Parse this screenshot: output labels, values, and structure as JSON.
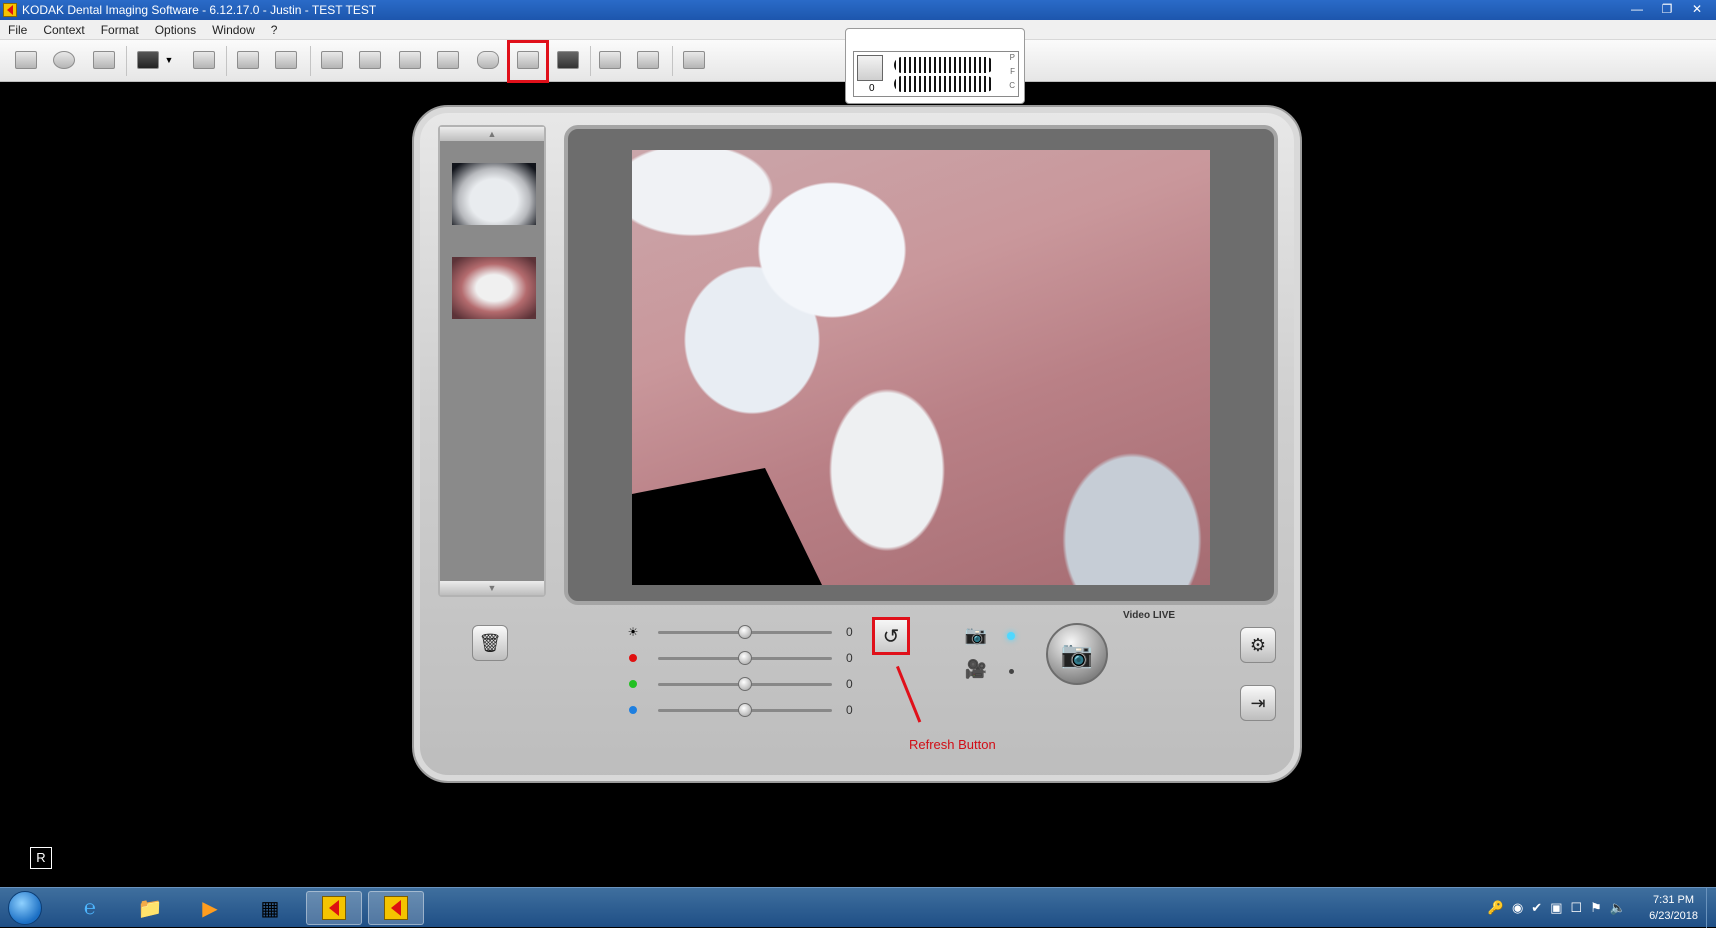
{
  "window": {
    "title": "KODAK Dental Imaging Software - 6.12.17.0 - Justin  - TEST TEST",
    "controls": [
      "minimize-icon",
      "restore-icon",
      "close-icon"
    ]
  },
  "menu": [
    "File",
    "Context",
    "Format",
    "Options",
    "Window",
    "?"
  ],
  "toolbar": {
    "buttons": [
      "open-folder-icon",
      "cd-icon",
      "compare-icon",
      "layout-icon",
      "dropdown-arrow-icon",
      "tooth-tools-icon",
      "email-icon",
      "print-icon",
      "intraoral-sensor-icon",
      "panoramic-icon",
      "cephalometric-icon",
      "scanner-icon",
      "cr-icon",
      "intraoral-camera-icon",
      "acquire-icon",
      "photo-icon",
      "presentation-icon",
      "exit-icon"
    ],
    "highlighted": "intraoral-camera-icon"
  },
  "chart_popup": {
    "count": "0",
    "labels": [
      "P",
      "F",
      "C"
    ]
  },
  "camera": {
    "status_label": "Video LIVE",
    "sliders": [
      {
        "name": "brightness",
        "icon": "sun-icon",
        "value": "0",
        "position": 0.5
      },
      {
        "name": "red",
        "icon": "red-dot",
        "color": "#e01010",
        "value": "0",
        "position": 0.5
      },
      {
        "name": "green",
        "icon": "green-dot",
        "color": "#22c022",
        "value": "0",
        "position": 0.5
      },
      {
        "name": "blue",
        "icon": "blue-dot",
        "color": "#1e7fe0",
        "value": "0",
        "position": 0.5
      }
    ],
    "refresh_annotation": "Refresh Button",
    "mode": "photo",
    "r_label": "R"
  },
  "taskbar": {
    "items": [
      "start-orb",
      "internet-explorer-icon",
      "file-explorer-icon",
      "media-player-icon",
      "grid-app-icon",
      "kodak-app-icon",
      "kodak-app-icon"
    ],
    "time": "7:31 PM",
    "date": "6/23/2018"
  },
  "colors": {
    "title_bar": "#1d56ad",
    "annotation_red": "#e0101a",
    "led_active": "#4fd8ff"
  }
}
